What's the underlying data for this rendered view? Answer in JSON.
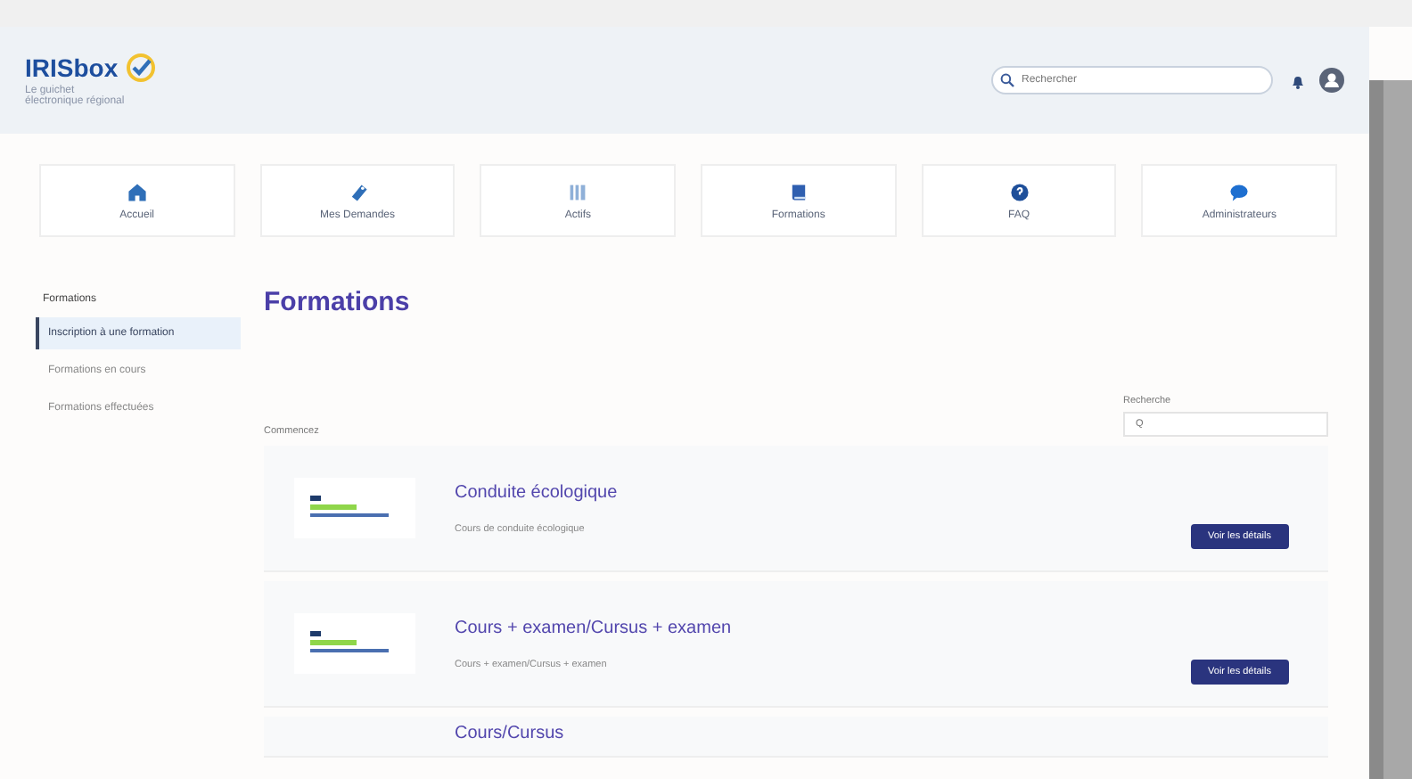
{
  "header": {
    "logo": "IRISbox",
    "tagline": "Le guichet électronique régional",
    "search": {
      "placeholder": "Rechercher"
    }
  },
  "nav": [
    {
      "label": "Accueil"
    },
    {
      "label": "Mes Demandes"
    },
    {
      "label": "Actifs"
    },
    {
      "label": "Formations"
    },
    {
      "label": "FAQ"
    },
    {
      "label": "Administrateurs"
    }
  ],
  "sidebar": {
    "title": "Formations",
    "items": [
      {
        "label": "Inscription à une formation",
        "selected": true
      },
      {
        "label": "Formations en cours",
        "selected": false
      },
      {
        "label": "Formations effectuées",
        "selected": false
      }
    ]
  },
  "page": {
    "title": "Formations",
    "list_label": "Commencez",
    "filter": {
      "label": "Recherche",
      "placeholder": "Q"
    }
  },
  "courses": [
    {
      "title": "Conduite écologique",
      "description": "Cours de conduite écologique",
      "button": "Voir les détails"
    },
    {
      "title": "Cours + examen/Cursus + examen",
      "description": "Cours + examen/Cursus + examen",
      "button": "Voir les détails"
    },
    {
      "title": "Cours/Cursus"
    }
  ]
}
